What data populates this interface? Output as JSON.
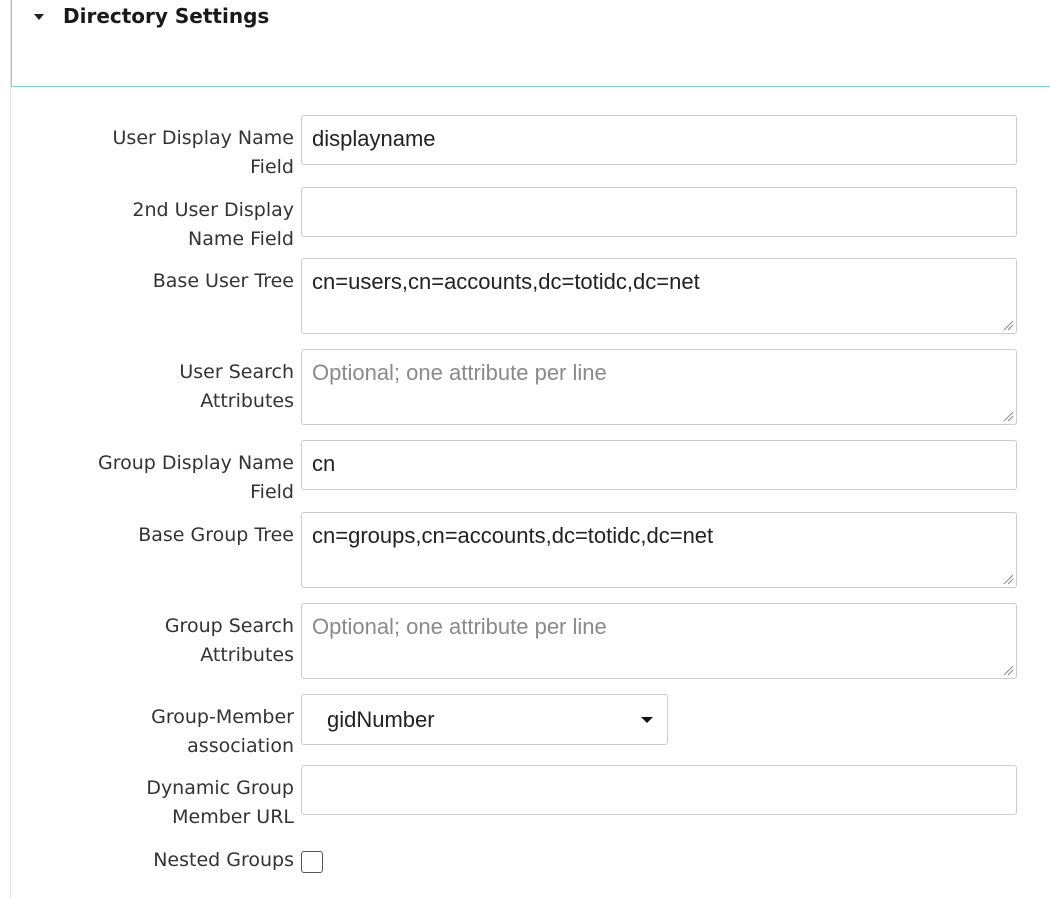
{
  "section": {
    "title": "Directory Settings",
    "expanded": true,
    "caret_icon": "caret-down-icon"
  },
  "fields": {
    "user_display_name": {
      "label": "User Display Name Field",
      "value": "displayname",
      "placeholder": ""
    },
    "second_user_display_name": {
      "label": "2nd User Display Name Field",
      "value": "",
      "placeholder": ""
    },
    "base_user_tree": {
      "label": "Base User Tree",
      "value": "cn=users,cn=accounts,dc=totidc,dc=net",
      "placeholder": ""
    },
    "user_search_attributes": {
      "label": "User Search Attributes",
      "value": "",
      "placeholder": "Optional; one attribute per line"
    },
    "group_display_name": {
      "label": "Group Display Name Field",
      "value": "cn",
      "placeholder": ""
    },
    "base_group_tree": {
      "label": "Base Group Tree",
      "value": "cn=groups,cn=accounts,dc=totidc,dc=net",
      "placeholder": ""
    },
    "group_search_attributes": {
      "label": "Group Search Attributes",
      "value": "",
      "placeholder": "Optional; one attribute per line"
    },
    "group_member_association": {
      "label": "Group-Member association",
      "selected": "gidNumber"
    },
    "dynamic_group_member_url": {
      "label": "Dynamic Group Member URL",
      "value": "",
      "placeholder": ""
    },
    "nested_groups": {
      "label": "Nested Groups",
      "checked": false
    }
  },
  "colors": {
    "header_border": "#7fd1cf",
    "input_border": "#cccccc",
    "label_text": "#333333",
    "placeholder_text": "#8a8a8a"
  }
}
